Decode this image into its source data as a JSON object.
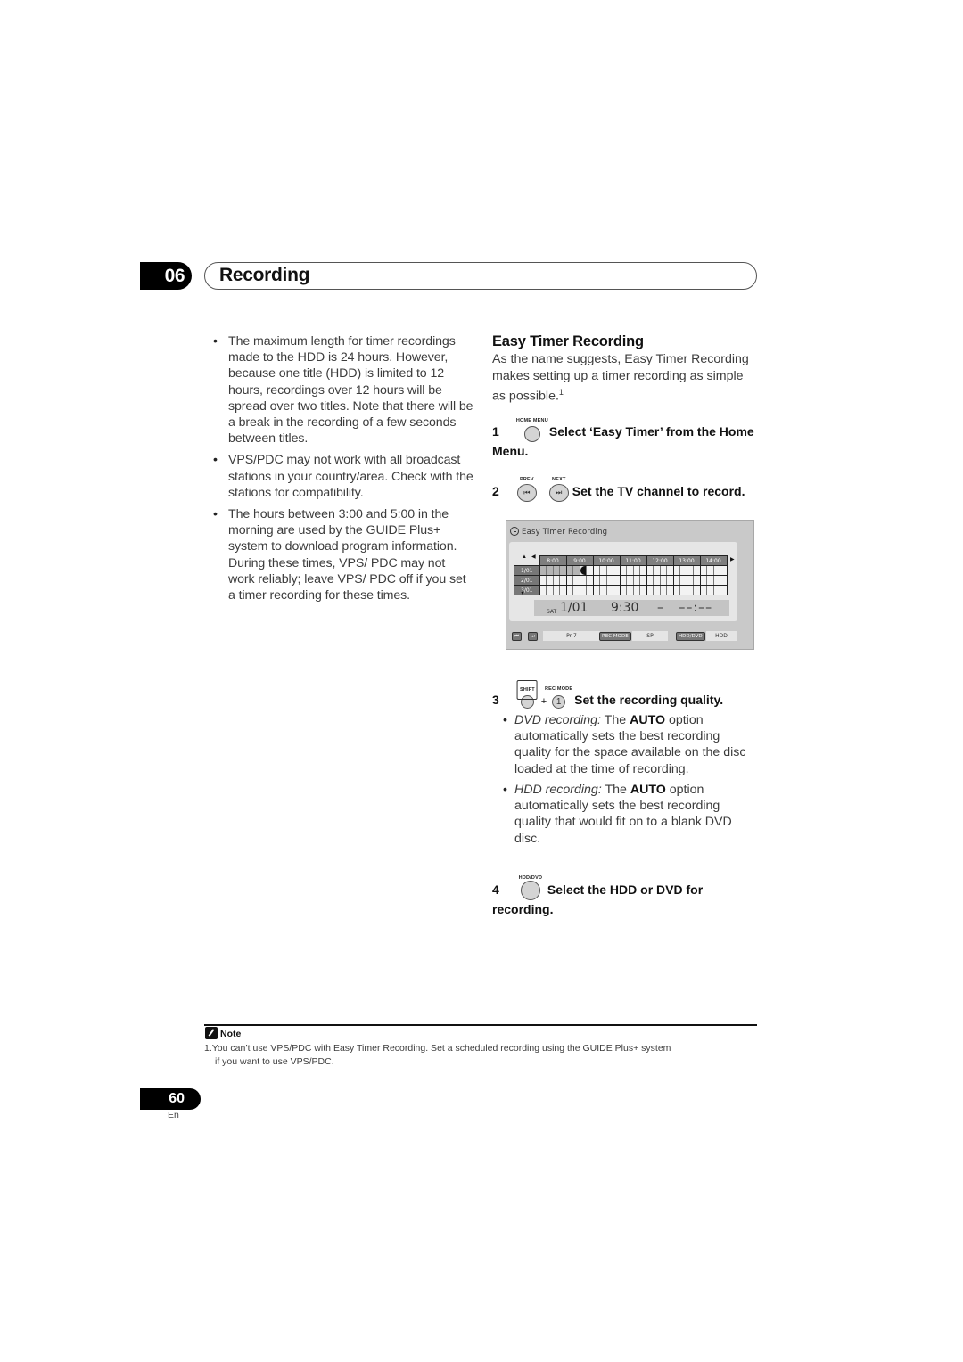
{
  "chapter": {
    "number": "06",
    "title": "Recording"
  },
  "left_column": {
    "bullets": [
      "The maximum length for timer recordings made to the HDD is 24 hours. However, because one title (HDD) is limited to 12 hours, recordings over 12 hours will be spread over two titles. Note that there will be a break in the recording of a few seconds between titles.",
      "VPS/PDC may not work with all broadcast stations in your country/area. Check with the stations for compatibility.",
      "The hours between 3:00 and 5:00 in the morning are used by the GUIDE Plus+ system to download program information. During these times, VPS/ PDC may not work reliably; leave VPS/ PDC off if you set a timer recording for these times."
    ]
  },
  "section": {
    "title": "Easy Timer Recording",
    "intro": "As the name suggests, Easy Timer Recording makes setting up a timer recording as simple as possible.",
    "intro_footnote_ref": "1"
  },
  "steps": [
    {
      "number": "1",
      "buttons": [
        {
          "caption": "HOME MENU",
          "icon": "round-button-icon"
        }
      ],
      "text": "Select ‘Easy Timer’ from the Home Menu."
    },
    {
      "number": "2",
      "buttons": [
        {
          "caption": "PREV",
          "icon": "skip-previous-icon",
          "glyph": "⏮"
        },
        {
          "caption": "NEXT",
          "icon": "skip-next-icon",
          "glyph": "⏭"
        }
      ],
      "text": "Set the TV channel to record."
    },
    {
      "number": "3",
      "buttons": [
        {
          "caption": "SHIFT",
          "icon": "round-button-icon"
        },
        {
          "caption": "REC MODE",
          "icon": "number-1-button-icon",
          "glyph": "1"
        }
      ],
      "plus": "+",
      "text": "Set the recording quality.",
      "sub_bullets": [
        {
          "italic": "DVD recording:",
          "pre": " The ",
          "bold": "AUTO",
          "post": " option automatically sets the best recording quality for the space available on the disc loaded at the time of recording."
        },
        {
          "italic": "HDD recording:",
          "pre": " The ",
          "bold": "AUTO",
          "post": " option automatically sets the best recording quality that would fit on to a blank DVD disc."
        }
      ]
    },
    {
      "number": "4",
      "buttons": [
        {
          "caption": "HDD/DVD",
          "icon": "round-button-icon"
        }
      ],
      "text": "Select the HDD or DVD for recording."
    }
  ],
  "screen": {
    "title": "Easy Timer Recording",
    "hours": [
      "8:00",
      "9:00",
      "10:00",
      "11:00",
      "12:00",
      "13:00",
      "14:00"
    ],
    "dates": [
      "1/01",
      "2/01",
      "3/01"
    ],
    "recording": {
      "date": "1/01",
      "start": "8:00",
      "end_cursor": "9:30"
    },
    "day": "SAT",
    "date": "1/01",
    "start_time": "9:30",
    "separator": "–",
    "end_time": "––:––",
    "footer": {
      "channel_label": "Pr 7",
      "rec_mode_key": "REC MODE",
      "rec_mode_value": "SP",
      "drive_key": "HDD/DVD",
      "drive_value": "HDD"
    }
  },
  "note": {
    "heading": "Note",
    "items": [
      {
        "line1": "1.You can’t use VPS/PDC with Easy Timer Recording. Set a scheduled recording using the GUIDE Plus+ system",
        "line2": "if you want to use VPS/PDC."
      }
    ]
  },
  "page": {
    "number": "60",
    "language": "En"
  }
}
